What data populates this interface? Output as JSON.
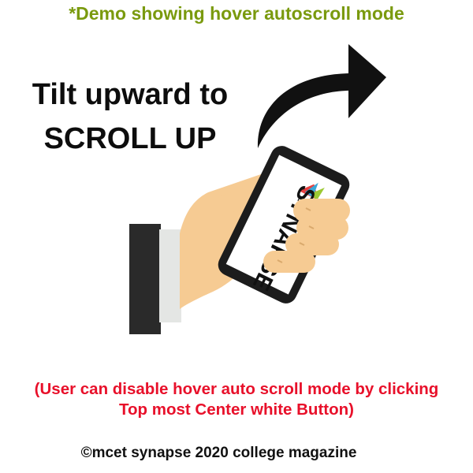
{
  "demo_caption": "*Demo showing hover autoscroll mode",
  "headline": {
    "line1": "Tilt upward to",
    "line2": "SCROLL UP"
  },
  "phone_screen": {
    "brand_text": "SYNAPSE",
    "logo_text": "mcet"
  },
  "note": {
    "line1": "(User can disable hover auto scroll mode by clicking",
    "line2": "Top most Center white Button)"
  },
  "copyright": "©mcet synapse 2020 college magazine",
  "colors": {
    "caption": "#7a9a0e",
    "note": "#e8102a",
    "skin": "#f6cb93",
    "phone": "#1c1c1c",
    "sleeve": "#2a2a2a",
    "cuff": "#e4e6e4"
  },
  "icons": {
    "arrow": "curved-arrow-up-right-icon",
    "hand": "hand-holding-phone-icon"
  }
}
